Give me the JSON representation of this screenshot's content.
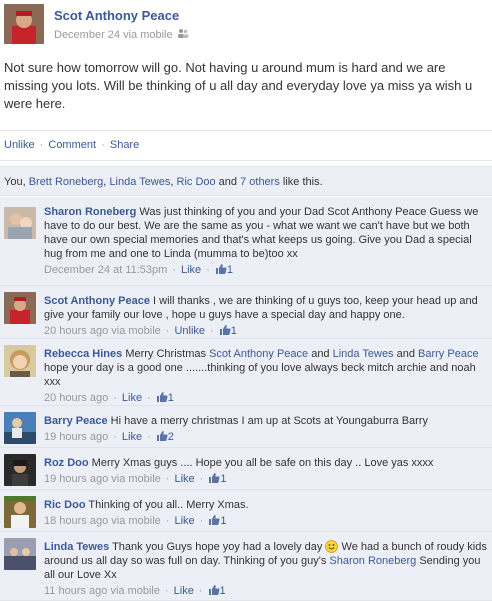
{
  "post": {
    "author": "Scot Anthony Peace",
    "date": "December 24 via mobile",
    "status": "Not sure how tomorrow will go. Not having u around mum is hard and we are missing you lots. Will be thinking of u all day and everyday love ya miss ya wish u were here.",
    "actions": {
      "unlike": "Unlike",
      "comment": "Comment",
      "share": "Share",
      "dot": "·"
    },
    "likes": {
      "prefix": "You, ",
      "name1": "Brett Roneberg",
      "comma": ", ",
      "name2": "Linda Tewes",
      "name3": "Ric Doo",
      "and": " and ",
      "others": "7 others",
      "suffix": " like this."
    }
  },
  "comments": [
    {
      "name": "Sharon Roneberg",
      "text": "Was just thinking of you and your Dad Scot Anthony Peace Guess we have to do our best. We are the same as you - what we want we can't have but we both have our own special memories and that's what keeps us going. Give you Dad a special hug from me and one to Linda (mumma to be)too xx",
      "time": "December 24 at 11:53pm",
      "like": "Like",
      "count": "1"
    },
    {
      "name": "Scot Anthony Peace",
      "text": "I will thanks , we are thinking of u guys too, keep your head up and give your family our love , hope u guys have a special day and happy one.",
      "time": "20 hours ago via mobile",
      "like": "Unlike",
      "count": "1"
    },
    {
      "name": "Rebecca Hines",
      "text_a": "Merry Christmas ",
      "link_a": "Scot Anthony Peace",
      "text_b": " and ",
      "link_b": "Linda Tewes",
      "text_c": " and ",
      "link_c": "Barry Peace",
      "text_d": " hope your day is a good one .......thinking of you love always beck mitch archie and noah xxx",
      "time": "20 hours ago",
      "like": "Like",
      "count": "1"
    },
    {
      "name": "Barry Peace",
      "text": "Hi have a merry christmas I am up at Scots at Youngaburra Barry",
      "time": "19 hours ago",
      "like": "Like",
      "count": "2"
    },
    {
      "name": "Roz Doo",
      "text": "Merry Xmas guys .... Hope you all be safe on this day .. Love yas xxxx",
      "time": "19 hours ago via mobile",
      "like": "Like",
      "count": "1"
    },
    {
      "name": "Ric Doo",
      "text": "Thinking of you all.. Merry Xmas.",
      "time": "18 hours ago via mobile",
      "like": "Like",
      "count": "1"
    },
    {
      "name": "Linda Tewes",
      "text_a": "Thank you Guys hope yoy had a lovely day ",
      "text_b": " We had a bunch of roudy kids around us all day so was full on day. Thinking of you guy's ",
      "link_a": "Sharon Roneberg",
      "text_c": " Sending you all our Love Xx",
      "time": "11 hours ago via mobile",
      "like": "Like",
      "count": "1"
    }
  ],
  "colors": {
    "link": "#3b5998",
    "comment_bg": "#eceff5",
    "meta": "#999999"
  }
}
